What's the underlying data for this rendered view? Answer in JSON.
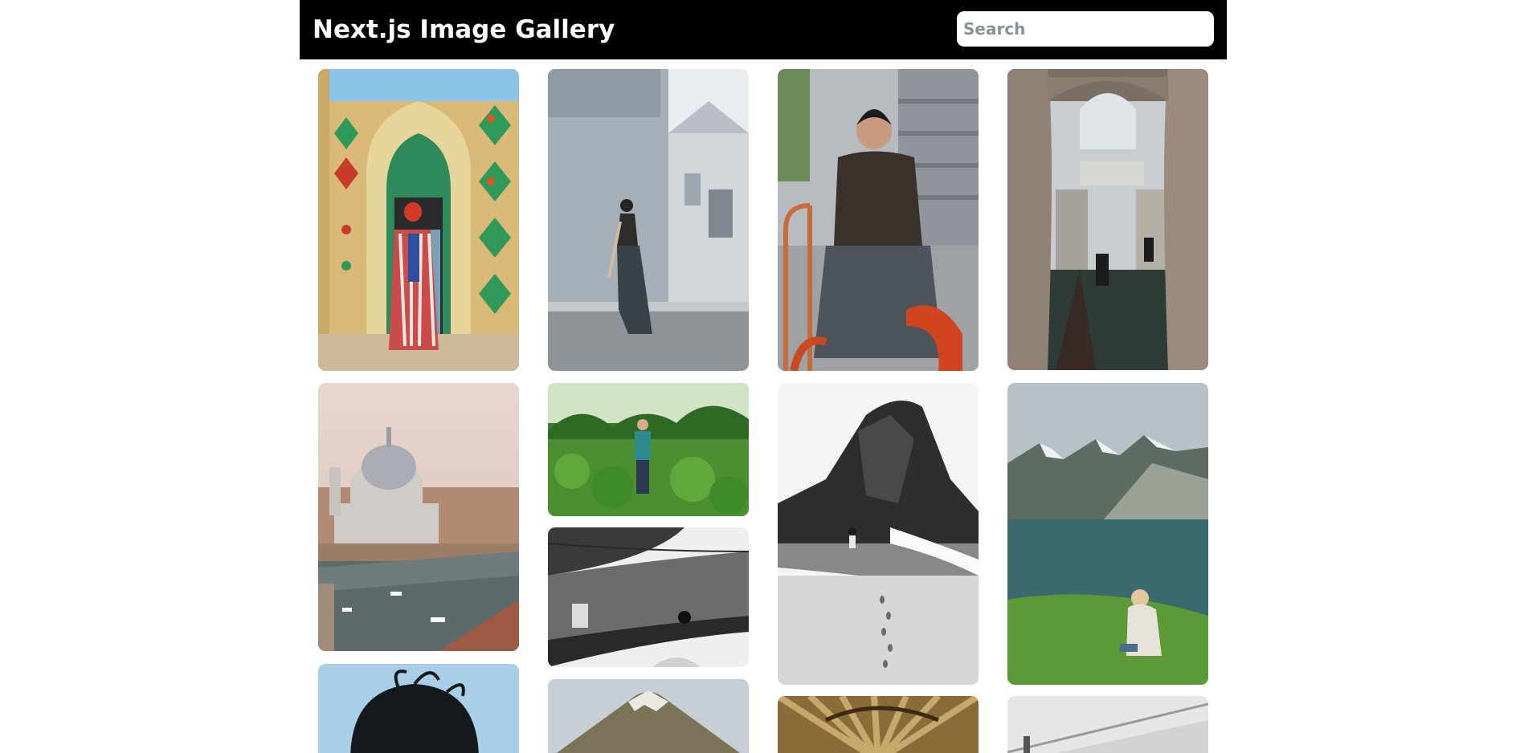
{
  "header": {
    "title": "Next.js Image Gallery",
    "search_placeholder": "Search",
    "search_value": ""
  },
  "colors": {
    "header_bg": "#000000",
    "page_bg": "#ffffff"
  },
  "gallery": {
    "photos": [
      {
        "subject": "colorful-moorish-doorway-portrait"
      },
      {
        "subject": "woman-dancing-street-modern-building"
      },
      {
        "subject": "woman-posing-street-stairs"
      },
      {
        "subject": "venice-canal-bridge-of-sighs-arch"
      },
      {
        "subject": "venice-basilica-grand-canal"
      },
      {
        "subject": "farmer-in-green-field"
      },
      {
        "subject": "black-white-awning-cat"
      },
      {
        "subject": "black-white-beach-rock-child"
      },
      {
        "subject": "mountain-lake-woman-sitting"
      },
      {
        "subject": "person-with-windblown-hair"
      },
      {
        "subject": "volcano-mountain-peak"
      },
      {
        "subject": "thatched-umbrella-underside"
      },
      {
        "subject": "white-stairs-architecture"
      }
    ]
  }
}
